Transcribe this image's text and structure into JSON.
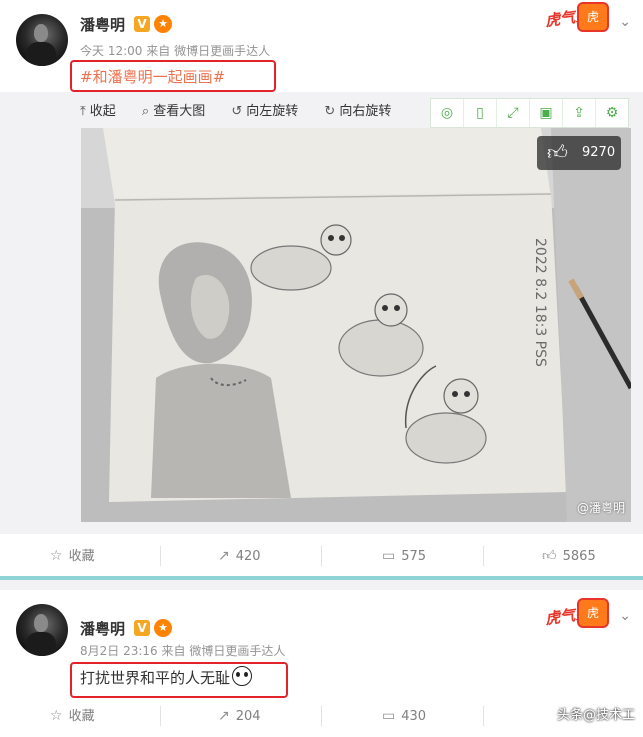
{
  "post1": {
    "author": "潘粤明",
    "verified_badge": "V",
    "medal_icon": "medal-icon",
    "time": "今天 12:00",
    "source_prefix": "来自",
    "source": "微博日更画手达人",
    "text": "#和潘粤明一起画画#",
    "event_logo": "虎气来了",
    "media_toolbar": {
      "collapse": "收起",
      "view_large": "查看大图",
      "rotate_left": "向左旋转",
      "rotate_right": "向右旋转"
    },
    "image_likes": "9270",
    "image_watermark": "@潘粤明",
    "drawing_signature": "2022 8.2 18:3 PSS",
    "actions": {
      "favorite": "收藏",
      "repost": "420",
      "comment": "575",
      "like": "5865"
    }
  },
  "post2": {
    "author": "潘粤明",
    "verified_badge": "V",
    "time": "8月2日 23:16",
    "source_prefix": "来自",
    "source": "微博日更画手达人",
    "text": "打扰世界和平的人无耻",
    "event_logo": "虎气来了",
    "actions": {
      "favorite": "收藏",
      "repost": "204",
      "comment": "430"
    }
  },
  "corner_watermark": "头条@技术工",
  "colors": {
    "hashtag": "#eb7350",
    "highlight_box": "#e3232a",
    "tool_green": "#4cae4c",
    "teal_divider": "#8fd3d6"
  }
}
